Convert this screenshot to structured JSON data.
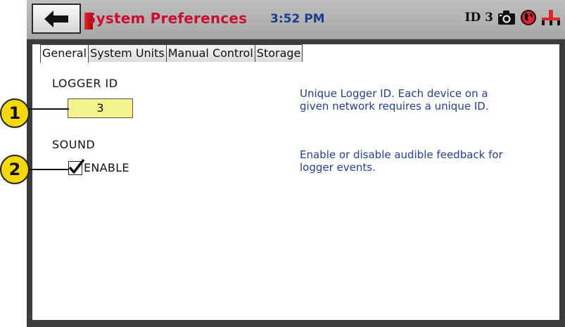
{
  "header": {
    "title": "System Preferences",
    "time": "3:52 PM",
    "device_id_label": "ID 3"
  },
  "tabs": [
    {
      "label": "General",
      "active": true
    },
    {
      "label": "System Units",
      "active": false
    },
    {
      "label": "Manual Control",
      "active": false
    },
    {
      "label": "Storage",
      "active": false
    }
  ],
  "general": {
    "logger_id": {
      "label": "LOGGER ID",
      "value": "3",
      "description_line1": "Unique Logger ID.  Each device on a",
      "description_line2": "given network requires a unique ID."
    },
    "sound": {
      "label": "SOUND",
      "checkbox_label": "ENABLE",
      "checked": true,
      "description_line1": "Enable or disable audible feedback for",
      "description_line2": "logger events."
    }
  },
  "callouts": [
    "1",
    "2"
  ],
  "icons": [
    "back-arrow-icon",
    "camera-icon",
    "globe-icon",
    "network-icon",
    "checkmark-icon"
  ],
  "colors": {
    "title": "#c8102e",
    "clock": "#1a3d8f",
    "description": "#1f3f9a",
    "field_highlight": "#f4f28c",
    "callout": "#f5d80a"
  }
}
